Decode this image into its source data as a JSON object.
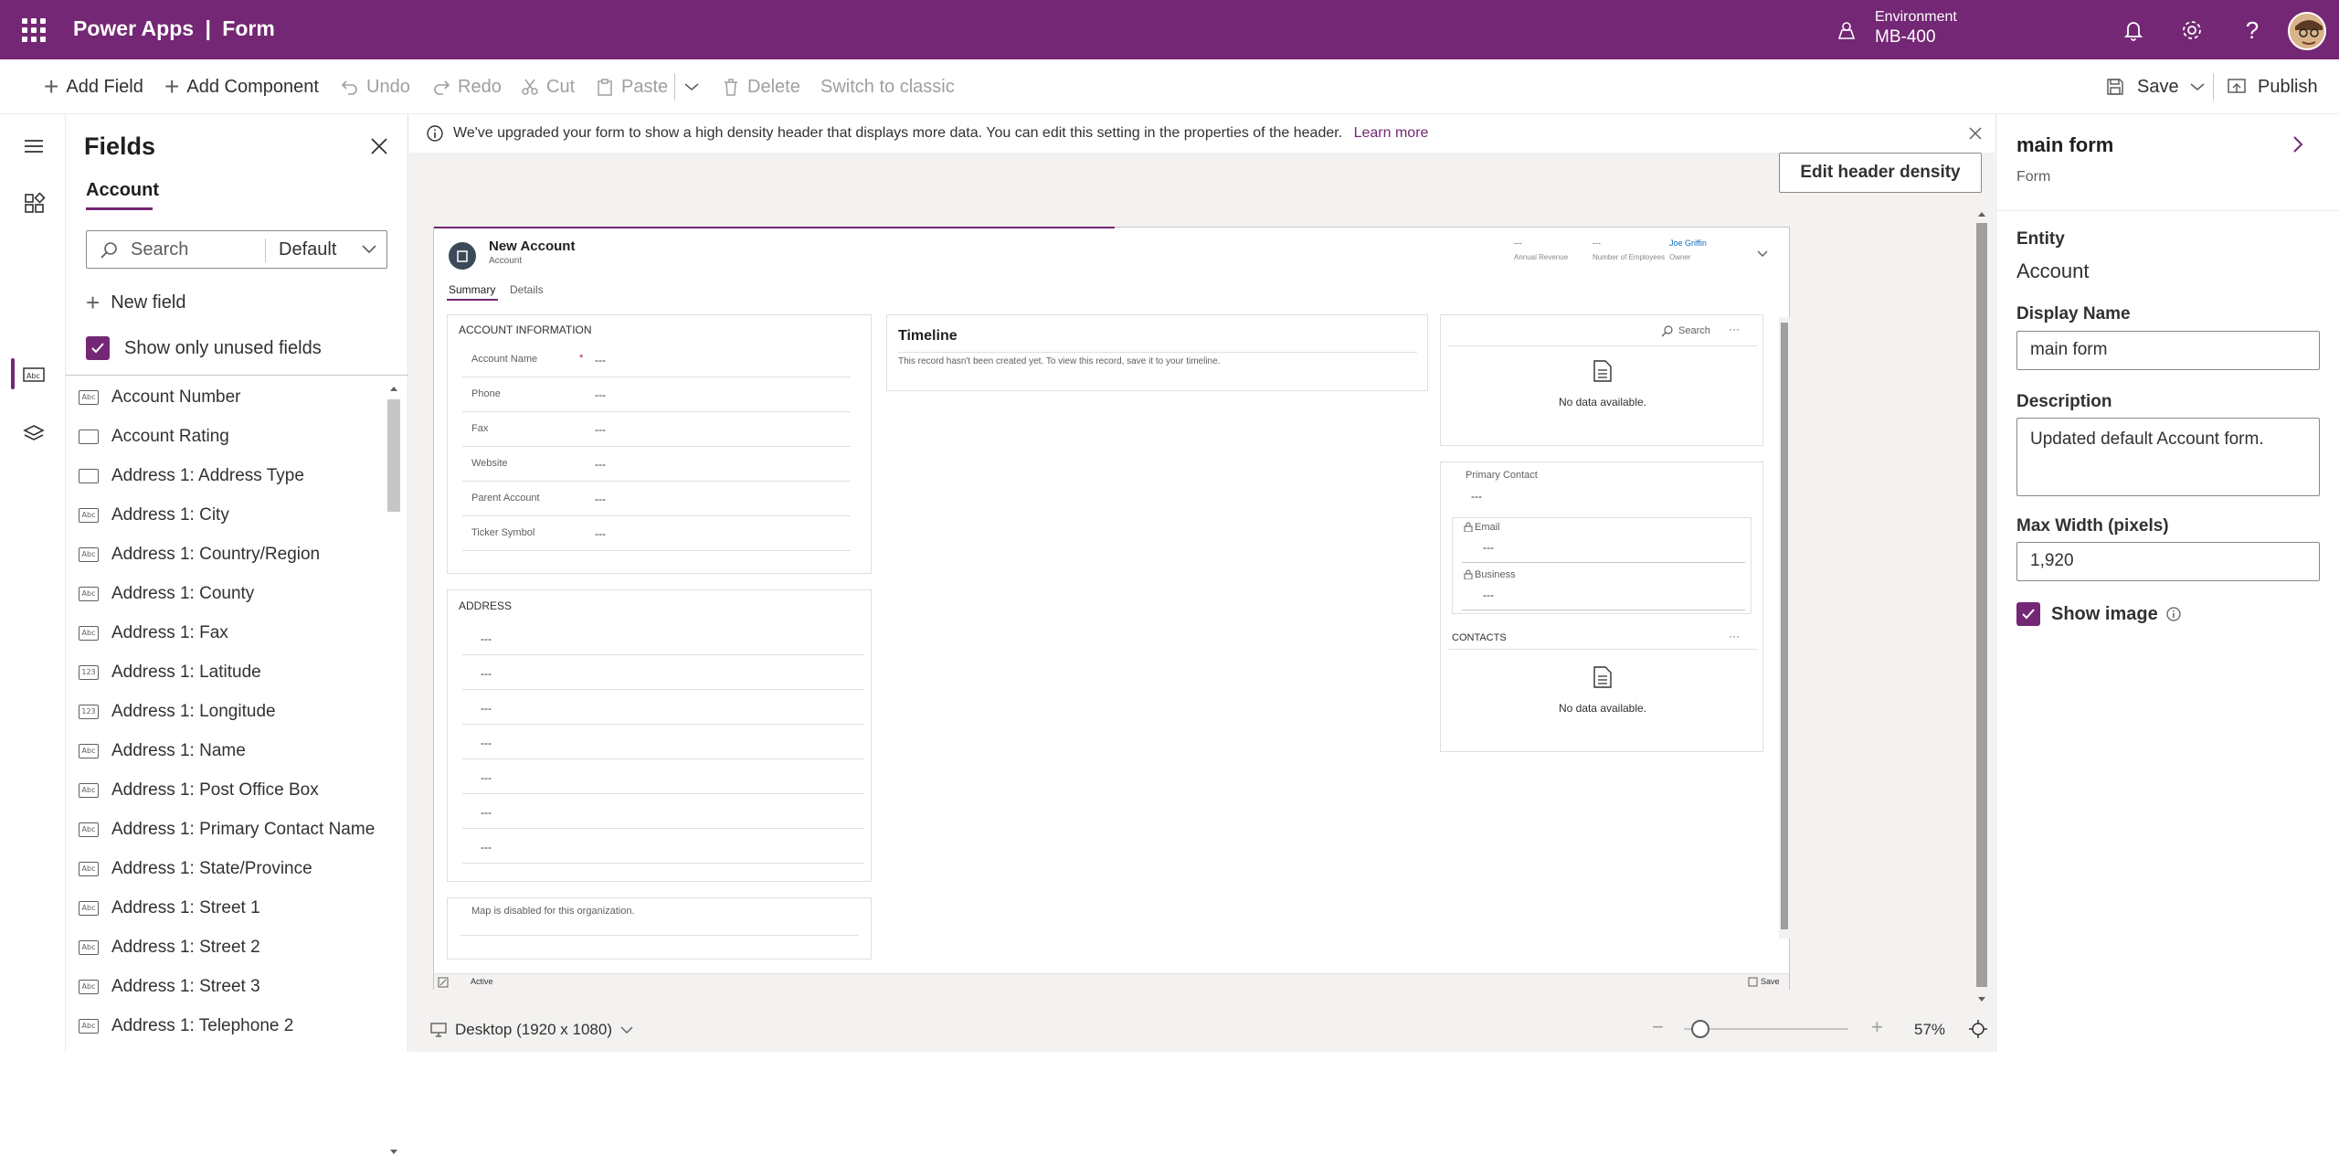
{
  "header": {
    "app_name": "Power Apps",
    "separator": "|",
    "page": "Form",
    "env_label": "Environment",
    "env_value": "MB-400"
  },
  "toolbar": {
    "add_field": "Add Field",
    "add_component": "Add Component",
    "undo": "Undo",
    "redo": "Redo",
    "cut": "Cut",
    "paste": "Paste",
    "delete": "Delete",
    "switch_classic": "Switch to classic",
    "save": "Save",
    "publish": "Publish"
  },
  "fields_panel": {
    "title": "Fields",
    "tab": "Account",
    "search_placeholder": "Search",
    "filter_value": "Default",
    "new_field": "New field",
    "show_unused": "Show only unused fields",
    "items": [
      {
        "label": "Account Number",
        "icon": "text-field-icon"
      },
      {
        "label": "Account Rating",
        "icon": "option-set-icon"
      },
      {
        "label": "Address 1: Address Type",
        "icon": "option-set-icon"
      },
      {
        "label": "Address 1: City",
        "icon": "text-field-icon"
      },
      {
        "label": "Address 1: Country/Region",
        "icon": "text-field-icon"
      },
      {
        "label": "Address 1: County",
        "icon": "text-field-icon"
      },
      {
        "label": "Address 1: Fax",
        "icon": "text-field-icon"
      },
      {
        "label": "Address 1: Latitude",
        "icon": "number-field-icon"
      },
      {
        "label": "Address 1: Longitude",
        "icon": "number-field-icon"
      },
      {
        "label": "Address 1: Name",
        "icon": "text-field-icon"
      },
      {
        "label": "Address 1: Post Office Box",
        "icon": "text-field-icon"
      },
      {
        "label": "Address 1: Primary Contact Name",
        "icon": "text-field-icon"
      },
      {
        "label": "Address 1: State/Province",
        "icon": "text-field-icon"
      },
      {
        "label": "Address 1: Street 1",
        "icon": "text-field-icon"
      },
      {
        "label": "Address 1: Street 2",
        "icon": "text-field-icon"
      },
      {
        "label": "Address 1: Street 3",
        "icon": "text-field-icon"
      },
      {
        "label": "Address 1: Telephone 2",
        "icon": "text-field-icon"
      }
    ]
  },
  "banner": {
    "text": "We've upgraded your form to show a high density header that displays more data. You can edit this setting in the properties of the header.",
    "link": "Learn more"
  },
  "edit_header_density": "Edit header density",
  "form": {
    "title": "New Account",
    "entity": "Account",
    "header_fields": [
      {
        "value": "---",
        "label": "Annual Revenue"
      },
      {
        "value": "---",
        "label": "Number of Employees"
      },
      {
        "value": "Joe Griffin",
        "label": "Owner"
      }
    ],
    "tabs": [
      "Summary",
      "Details"
    ],
    "account_info": {
      "title": "ACCOUNT INFORMATION",
      "required_mark": "*",
      "rows": [
        {
          "label": "Account Name",
          "value": "---"
        },
        {
          "label": "Phone",
          "value": "---"
        },
        {
          "label": "Fax",
          "value": "---"
        },
        {
          "label": "Website",
          "value": "---"
        },
        {
          "label": "Parent Account",
          "value": "---"
        },
        {
          "label": "Ticker Symbol",
          "value": "---"
        }
      ]
    },
    "address": {
      "title": "ADDRESS",
      "rows": [
        "---",
        "---",
        "---",
        "---",
        "---",
        "---",
        "---"
      ]
    },
    "map_text": "Map is disabled for this organization.",
    "timeline": {
      "title": "Timeline",
      "text": "This record hasn't been created yet.  To view this record, save it to your timeline."
    },
    "subgrid1": {
      "search": "Search",
      "more": "···",
      "empty": "No data available."
    },
    "contact": {
      "primary_label": "Primary Contact",
      "primary_value": "---",
      "email_label": "Email",
      "email_value": "---",
      "business_label": "Business",
      "business_value": "---"
    },
    "contacts": {
      "title": "CONTACTS",
      "more": "···",
      "empty": "No data available."
    },
    "footer_status": "Active",
    "footer_save": "Save"
  },
  "bottom": {
    "device": "Desktop (1920 x 1080)",
    "zoom": "57%",
    "zoom_level": 0.1
  },
  "properties": {
    "title": "main form",
    "subtitle": "Form",
    "entity_label": "Entity",
    "entity_value": "Account",
    "display_name_label": "Display Name",
    "display_name_value": "main form",
    "description_label": "Description",
    "description_value": "Updated default Account form.",
    "max_width_label": "Max Width (pixels)",
    "max_width_value": "1,920",
    "show_image": "Show image"
  },
  "colors": {
    "brand": "#742774",
    "link": "#742774",
    "owner_link": "#0f6cbd"
  }
}
